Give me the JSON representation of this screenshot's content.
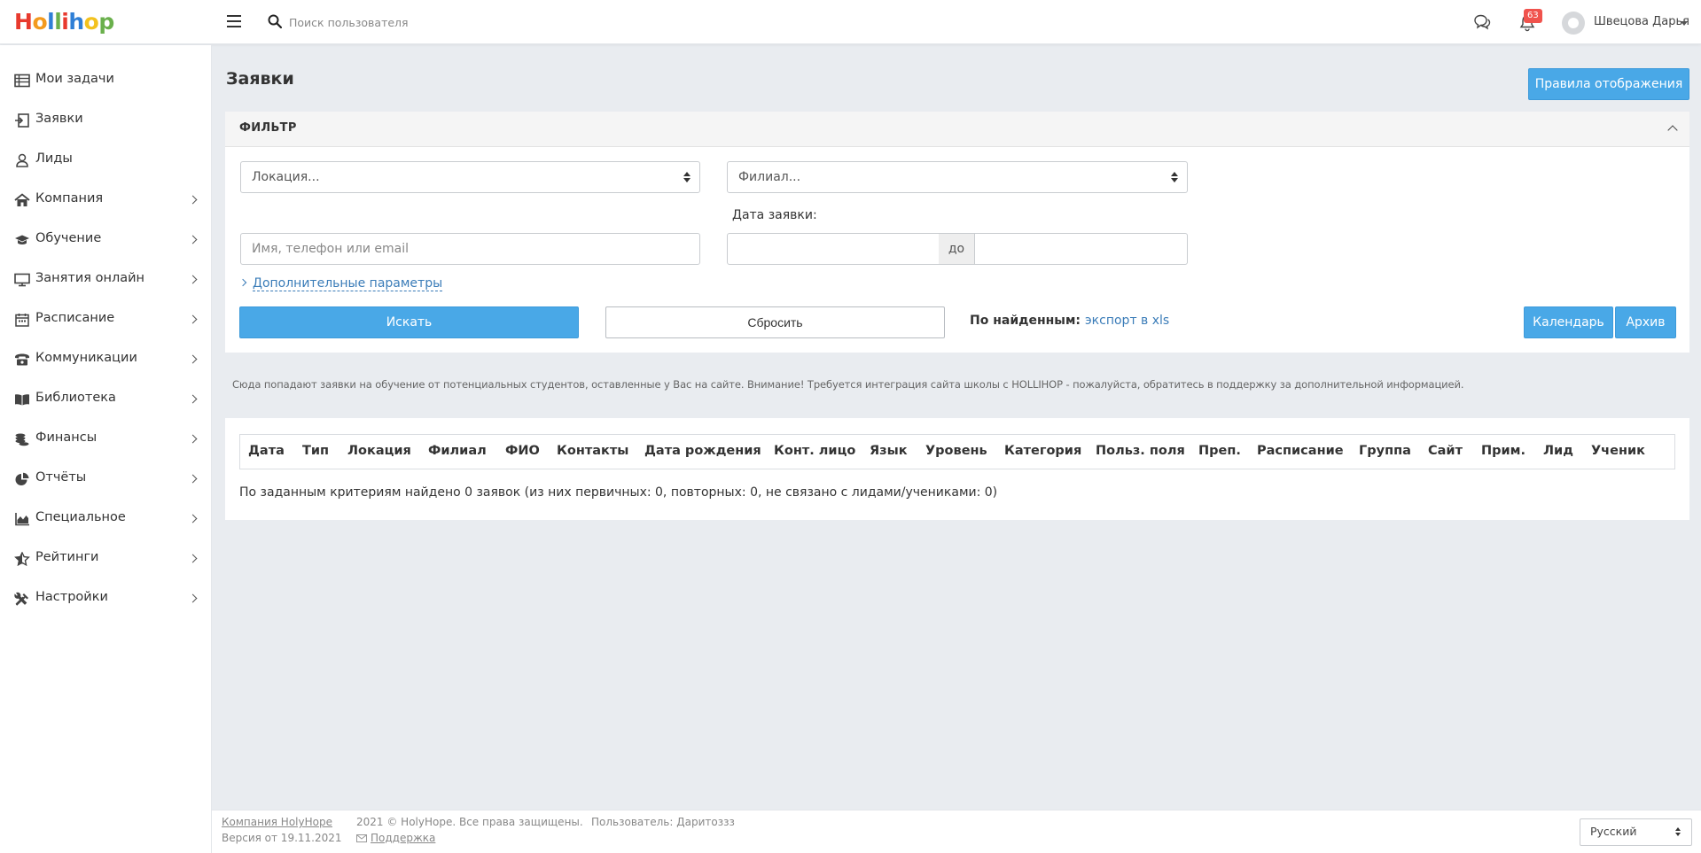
{
  "header": {
    "logo_letters": [
      "H",
      "o",
      "l",
      "l",
      "i",
      "h",
      "o",
      "p"
    ],
    "logo_colors": [
      "#e83a2e",
      "#f39a1e",
      "#2f7fd6",
      "#6ab04c",
      "#e83a2e",
      "#2f7fd6",
      "#f3c21e",
      "#6ab04c"
    ],
    "search_placeholder": "Поиск пользователя",
    "notifications_count": "63",
    "user_name": "Швецова Дарья"
  },
  "sidebar": {
    "items": [
      {
        "label": "Мои задачи",
        "icon": "list-icon",
        "has_submenu": false
      },
      {
        "label": "Заявки",
        "icon": "request-icon",
        "has_submenu": false
      },
      {
        "label": "Лиды",
        "icon": "user-icon",
        "has_submenu": false
      },
      {
        "label": "Компания",
        "icon": "home-icon",
        "has_submenu": true
      },
      {
        "label": "Обучение",
        "icon": "graduation-cap-icon",
        "has_submenu": true
      },
      {
        "label": "Занятия онлайн",
        "icon": "monitor-icon",
        "has_submenu": true
      },
      {
        "label": "Расписание",
        "icon": "calendar-icon",
        "has_submenu": true
      },
      {
        "label": "Коммуникации",
        "icon": "phone-icon",
        "has_submenu": true
      },
      {
        "label": "Библиотека",
        "icon": "book-icon",
        "has_submenu": true
      },
      {
        "label": "Финансы",
        "icon": "coins-icon",
        "has_submenu": true
      },
      {
        "label": "Отчёты",
        "icon": "pie-chart-icon",
        "has_submenu": true
      },
      {
        "label": "Специальное",
        "icon": "area-chart-icon",
        "has_submenu": true
      },
      {
        "label": "Рейтинги",
        "icon": "star-half-icon",
        "has_submenu": true
      },
      {
        "label": "Настройки",
        "icon": "tools-icon",
        "has_submenu": true
      }
    ]
  },
  "main": {
    "title": "Заявки",
    "rules_button": "Правила отображения",
    "filter": {
      "title": "ФИЛЬТР",
      "location_select": "Локация...",
      "branch_select": "Филиал...",
      "name_placeholder": "Имя, телефон или email",
      "date_label": "Дата заявки:",
      "date_from": "",
      "date_sep": "до",
      "date_to": "",
      "more_params": "Дополнительные параметры",
      "search_button": "Искать",
      "reset_button": "Сбросить",
      "found_label": "По найденным:",
      "export_link": "экспорт в xls",
      "calendar_button": "Календарь",
      "archive_button": "Архив"
    },
    "info_text": "Сюда попадают заявки на обучение от потенциальных студентов, оставленные у Вас на сайте. Внимание! Требуется интеграция сайта школы с HOLLIHOP - пожалуйста, обратитесь в поддержку за дополнительной информацией.",
    "table": {
      "columns": [
        "Дата",
        "Тип",
        "Локация",
        "Филиал",
        "ФИО",
        "Контакты",
        "Дата рождения",
        "Конт. лицо",
        "Язык",
        "Уровень",
        "Категория",
        "Польз. поля",
        "Преп.",
        "Расписание",
        "Группа",
        "Сайт",
        "Прим.",
        "Лид",
        "Ученик"
      ],
      "rows": []
    },
    "result_text": "По заданным критериям найдено 0 заявок (из них первичных: 0, повторных: 0, не связано с лидами/учениками: 0)"
  },
  "footer": {
    "company_link": "Компания HolyHope",
    "version": "Версия от 19.11.2021",
    "copyright": "2021 © HolyHope. Все права защищены.",
    "support_link": "Поддержка",
    "user_label": "Пользователь: Даритоззз",
    "language": "Русский"
  },
  "colors": {
    "accent": "#49a8e7",
    "link": "#3a7cb8",
    "badge": "#f0534d",
    "background": "#e9ecf0"
  }
}
